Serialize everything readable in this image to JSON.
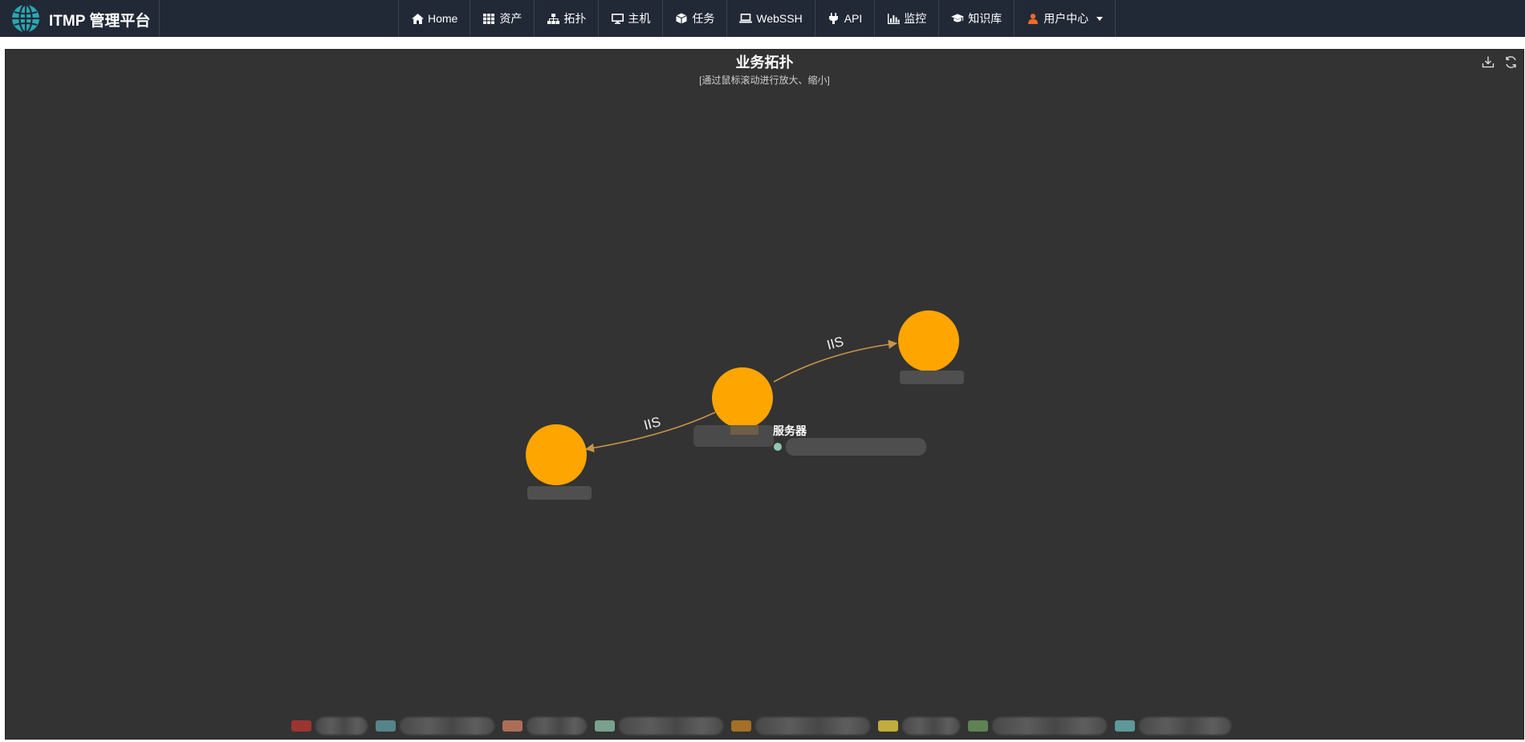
{
  "navbar": {
    "brand": "ITMP 管理平台",
    "items": [
      {
        "label": "Home",
        "icon": "home-icon"
      },
      {
        "label": "资产",
        "icon": "grid-icon"
      },
      {
        "label": "拓扑",
        "icon": "sitemap-icon"
      },
      {
        "label": "主机",
        "icon": "desktop-icon"
      },
      {
        "label": "任务",
        "icon": "cube-icon"
      },
      {
        "label": "WebSSH",
        "icon": "laptop-icon"
      },
      {
        "label": "API",
        "icon": "plug-icon"
      },
      {
        "label": "监控",
        "icon": "bar-chart-icon"
      },
      {
        "label": "知识库",
        "icon": "graduation-cap-icon"
      },
      {
        "label": "用户中心",
        "icon": "user-icon"
      }
    ]
  },
  "topology": {
    "title": "业务拓扑",
    "subtitle": "[通过鼠标滚动进行放大、缩小]",
    "node_color": "#FFA500",
    "edge_color": "#c9954a",
    "edges": [
      {
        "label": "IIS"
      },
      {
        "label": "IIS"
      }
    ],
    "tooltip": {
      "title": "服务器",
      "dot_color": "#91c7ae"
    },
    "legend_colors": [
      "#c23531",
      "#61a0a8",
      "#d48265",
      "#91c7ae",
      "#ca8622",
      "#f2d643",
      "#6e9e60",
      "#6cbcbc"
    ]
  },
  "colors": {
    "navbar_bg": "#222936",
    "panel_bg": "#333333",
    "user_icon": "#ec6a2c"
  }
}
